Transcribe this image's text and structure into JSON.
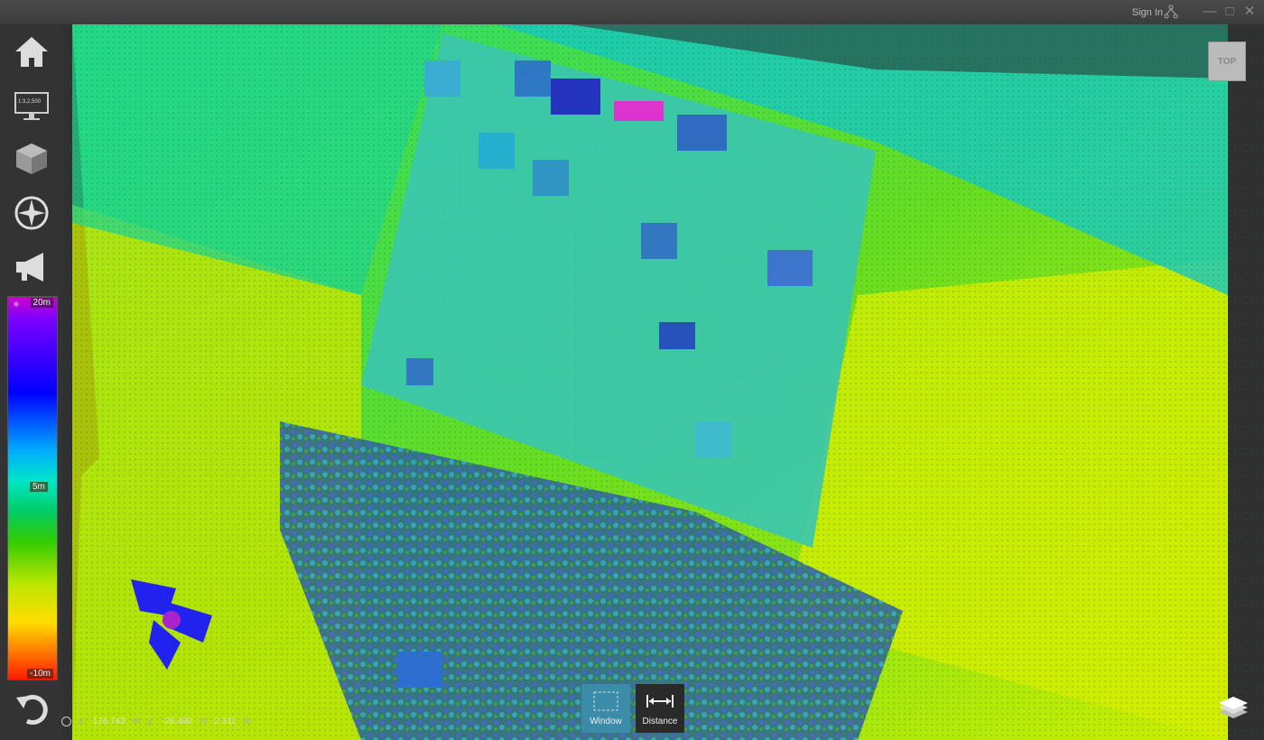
{
  "titlebar": {
    "signin_label": "Sign In",
    "icons": [
      "share-icon",
      "minimize-icon",
      "maximize-icon",
      "close-icon"
    ]
  },
  "sidebar": {
    "items": [
      {
        "name": "home-icon"
      },
      {
        "name": "scale-monitor-icon",
        "label": "1:3,2,500"
      },
      {
        "name": "cube-icon"
      },
      {
        "name": "compass-icon"
      },
      {
        "name": "megaphone-icon"
      }
    ],
    "undo_icon": "undo-icon"
  },
  "legend": {
    "max": "20m",
    "mid": "5m",
    "min": "-10m"
  },
  "coords": {
    "x_label": "x:",
    "x_value": "176.743",
    "x_unit": "m",
    "y_label": "y:",
    "y_value": "-26.460",
    "y_unit": "m",
    "z_value": "2.311",
    "z_unit": "m"
  },
  "view": {
    "top_label": "TOP"
  },
  "tools": {
    "window_label": "Window",
    "distance_label": "Distance"
  }
}
